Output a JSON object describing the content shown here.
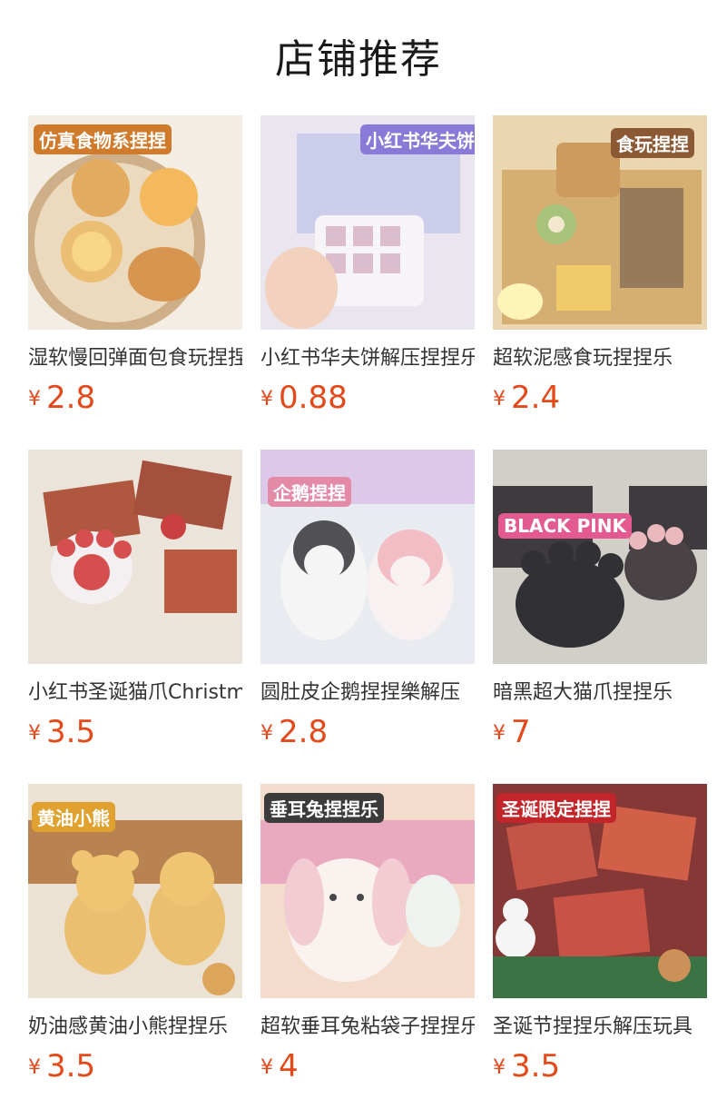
{
  "section_title": "店铺推荐",
  "currency": "¥",
  "products": [
    {
      "name": "湿软慢回弹面包食玩捏捏乐",
      "price": "2.8",
      "badge": "仿真食物系捏捏"
    },
    {
      "name": "小红书华夫饼解压捏捏乐",
      "price": "0.88",
      "badge": "小红书华夫饼捏捏"
    },
    {
      "name": "超软泥感食玩捏捏乐",
      "price": "2.4",
      "badge": "食玩捏捏"
    },
    {
      "name": "小红书圣诞猫爪Christmas",
      "price": "3.5",
      "badge": ""
    },
    {
      "name": "圆肚皮企鹅捏捏樂解压",
      "price": "2.8",
      "badge": "企鹅捏捏"
    },
    {
      "name": "暗黑超大猫爪捏捏乐",
      "price": "7",
      "badge": "BLACK PINK"
    },
    {
      "name": "奶油感黄油小熊捏捏乐",
      "price": "3.5",
      "badge": "黄油小熊"
    },
    {
      "name": "超软垂耳兔粘袋子捏捏乐",
      "price": "4",
      "badge": "垂耳兔捏捏乐"
    },
    {
      "name": "圣诞节捏捏乐解压玩具",
      "price": "3.5",
      "badge": "圣诞限定捏捏"
    }
  ]
}
